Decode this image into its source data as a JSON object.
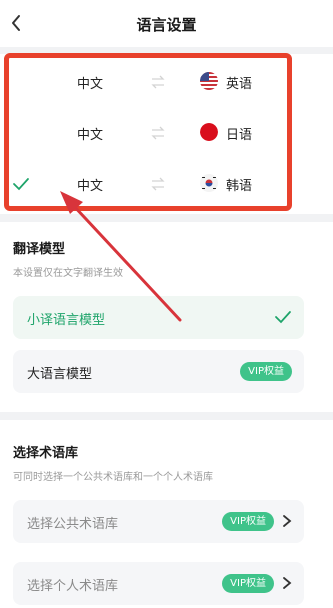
{
  "header": {
    "title": "语言设置"
  },
  "languages": [
    {
      "source": "中文",
      "target": "英语",
      "flag": "us-flag-icon",
      "selected": false
    },
    {
      "source": "中文",
      "target": "日语",
      "flag": "japan-flag-icon",
      "selected": false
    },
    {
      "source": "中文",
      "target": "韩语",
      "flag": "korea-flag-icon",
      "selected": true
    }
  ],
  "model_section": {
    "title": "翻译模型",
    "description": "本设置仅在文字翻译生效",
    "options": [
      {
        "label": "小译语言模型",
        "selected": true
      },
      {
        "label": "大语言模型",
        "badge": "VIP权益"
      }
    ]
  },
  "term_section": {
    "title": "选择术语库",
    "description": "可同时选择一个公共术语库和一个个人术语库",
    "options": [
      {
        "label": "选择公共术语库",
        "badge": "VIP权益"
      },
      {
        "label": "选择个人术语库",
        "badge": "VIP权益"
      }
    ]
  },
  "colors": {
    "accent": "#1ea46a",
    "badge": "#3fc38a",
    "highlight": "#e8412c"
  }
}
